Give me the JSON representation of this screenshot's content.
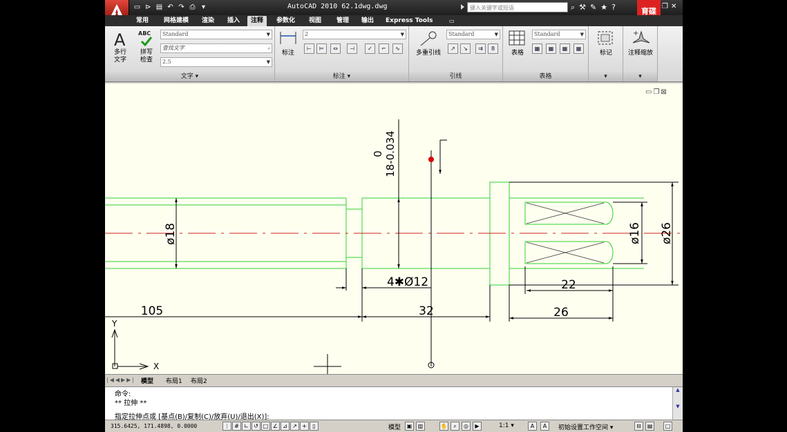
{
  "title_bar": {
    "title": "AutoCAD 2010  62.1dwg.dwg",
    "search_placeholder": "键入关键字或短语",
    "brand": "育碟\n教育"
  },
  "tabs": [
    {
      "label": "常用"
    },
    {
      "label": "网格建模"
    },
    {
      "label": "渲染"
    },
    {
      "label": "插入"
    },
    {
      "label": "注释",
      "active": true
    },
    {
      "label": "参数化"
    },
    {
      "label": "视图"
    },
    {
      "label": "管理"
    },
    {
      "label": "输出"
    },
    {
      "label": "Express Tools"
    }
  ],
  "ribbon": {
    "text_panel": {
      "multiline_text": "多行\n文字",
      "spell_check": "拼写\n检查",
      "abc_label": "ABC",
      "text_style": "Standard",
      "find_text_placeholder": "查找文字",
      "text_height": "2.5",
      "panel_title": "文字 ▾"
    },
    "dim_panel": {
      "dim_label": "标注",
      "dim_style": "2",
      "panel_title": "标注 ▾"
    },
    "leader_panel": {
      "mleader_label": "多重引线",
      "mleader_style": "Standard",
      "panel_title": "引线"
    },
    "table_panel": {
      "table_label": "表格",
      "table_style": "Standard",
      "panel_title": "表格"
    },
    "mark_panel": {
      "label": "标记",
      "panel_title": "▾"
    },
    "scale_panel": {
      "label": "注释缩放",
      "panel_title": "▾"
    }
  },
  "drawing": {
    "dims": {
      "d18": "ø18",
      "tol_upper": "0",
      "tol_lower": "18-0.034",
      "hole": "4✱Ø12",
      "d16": "ø16",
      "d26": "ø26",
      "l22": "22",
      "l105": "105",
      "l32": "32",
      "l26": "26"
    },
    "ucs_y": "Y",
    "ucs_x": "X",
    "colors": {
      "geometry": "#2fd22f",
      "dimension": "#000000",
      "centerline": "#cc2222",
      "grip": "#dd0000"
    }
  },
  "layout_tabs": [
    "模型",
    "布局1",
    "布局2"
  ],
  "command": {
    "line1": "命令:",
    "line2": "** 拉伸 **",
    "prompt": "指定拉伸点或 [基点(B)/复制(C)/放弃(U)/退出(X)]:"
  },
  "status": {
    "coords": "315.6425, 171.4898, 0.0000",
    "model_label": "模型",
    "scale": "1:1 ▾",
    "workspace": "初始设置工作空间 ▾"
  }
}
